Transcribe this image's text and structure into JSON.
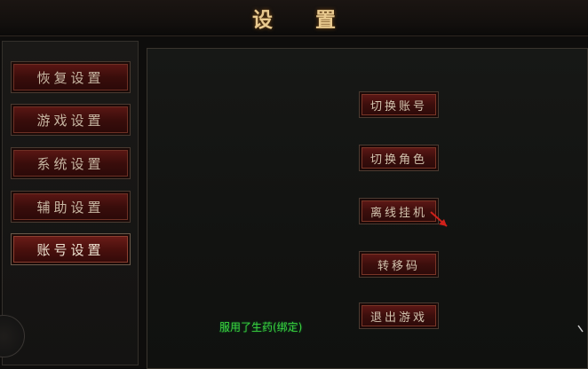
{
  "window": {
    "title": "设  置"
  },
  "tabs": [
    {
      "label": "恢复设置"
    },
    {
      "label": "游戏设置"
    },
    {
      "label": "系统设置"
    },
    {
      "label": "辅助设置"
    },
    {
      "label": "账号设置",
      "active": true
    }
  ],
  "account_actions": [
    {
      "label": "切换账号"
    },
    {
      "label": "切换角色"
    },
    {
      "label": "离线挂机"
    },
    {
      "label": "转移码"
    },
    {
      "label": "退出游戏"
    }
  ],
  "status_message": "服用了生药(绑定)",
  "colors": {
    "title_gold": "#e8c98f",
    "button_red": "#4a100d",
    "status_green": "#3fd33a"
  }
}
